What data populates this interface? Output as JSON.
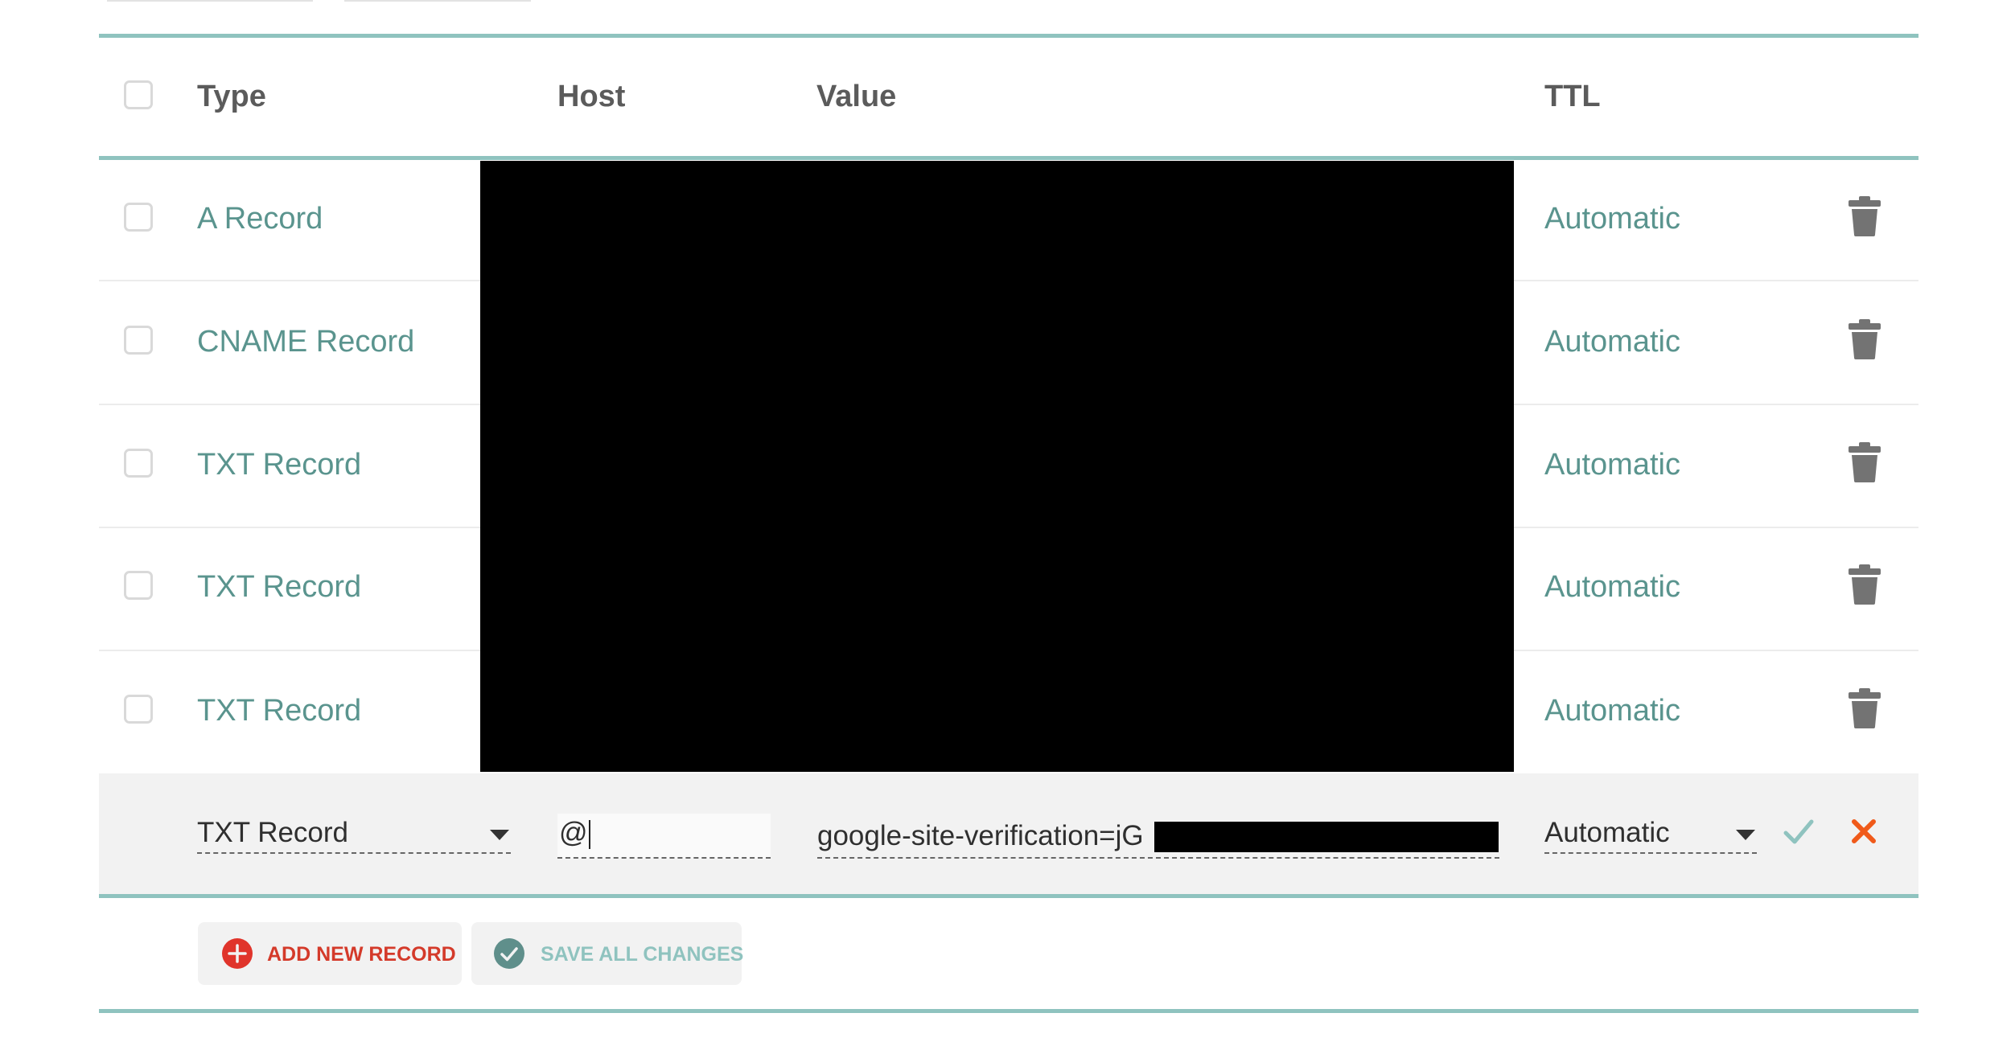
{
  "table": {
    "headers": {
      "type": "Type",
      "host": "Host",
      "value": "Value",
      "ttl": "TTL"
    },
    "rows": [
      {
        "type": "A Record",
        "ttl": "Automatic"
      },
      {
        "type": "CNAME Record",
        "ttl": "Automatic"
      },
      {
        "type": "TXT Record",
        "ttl": "Automatic"
      },
      {
        "type": "TXT Record",
        "ttl": "Automatic"
      },
      {
        "type": "TXT Record",
        "ttl": "Automatic"
      }
    ]
  },
  "edit_row": {
    "type": "TXT Record",
    "host": "@",
    "value": "google-site-verification=jG",
    "ttl": "Automatic"
  },
  "actions": {
    "add_label": "ADD NEW RECORD",
    "save_label": "SAVE ALL CHANGES"
  },
  "colors": {
    "accent_teal": "#8fc3bf",
    "record_text": "#5a948e",
    "add_red": "#e0342b",
    "cancel_orange": "#f05a1a"
  }
}
